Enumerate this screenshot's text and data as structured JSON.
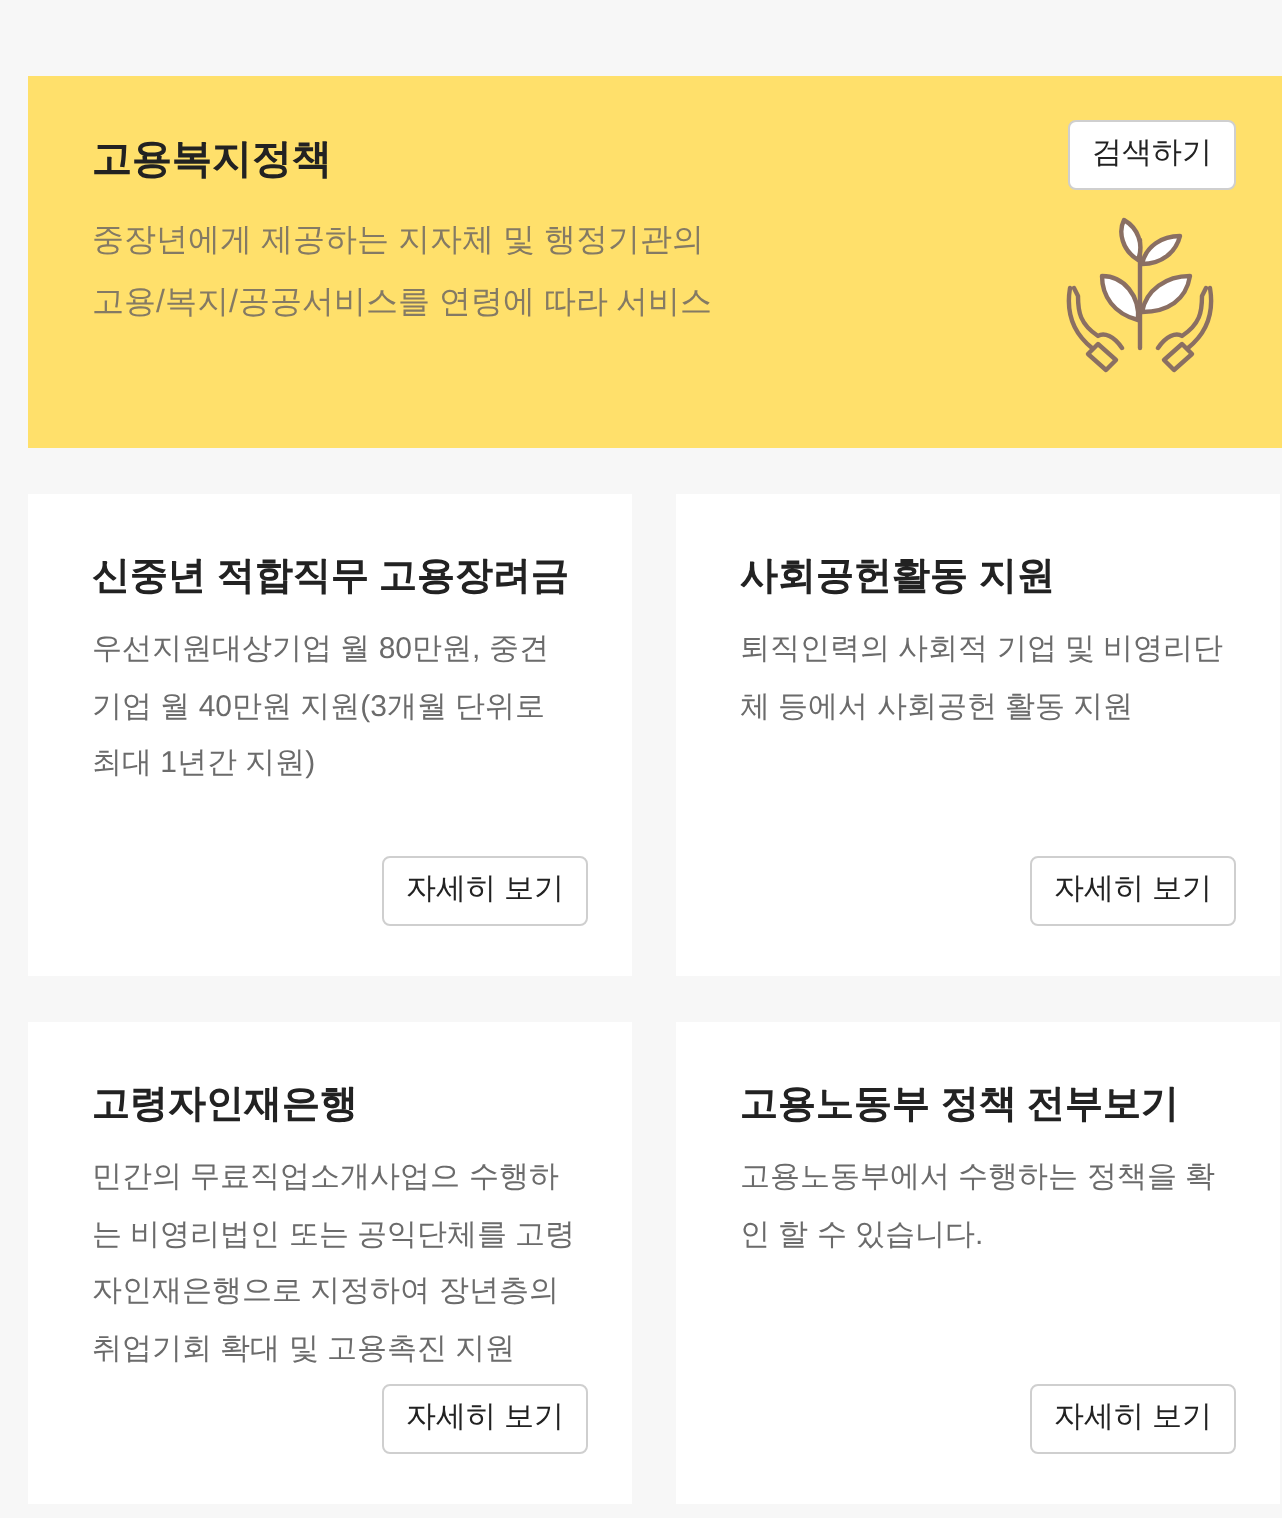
{
  "banner": {
    "title": "고용복지정책",
    "description": "중장년에게 제공하는 지자체 및 행정기관의 고용/복지/공공서비스를 연령에 따라 서비스",
    "button": "검색하기"
  },
  "cards": [
    {
      "title": "신중년 적합직무 고용장려금",
      "description": "우선지원대상기업 월 80만원, 중견기업 월 40만원 지원(3개월 단위로 최대 1년간 지원)",
      "button": "자세히 보기"
    },
    {
      "title": "사회공헌활동 지원",
      "description": "퇴직인력의 사회적 기업 및 비영리단체 등에서 사회공헌 활동 지원",
      "button": "자세히 보기"
    },
    {
      "title": "고령자인재은행",
      "description": "민간의 무료직업소개사업으 수행하는 비영리법인 또는 공익단체를 고령자인재은행으로 지정하여 장년층의 취업기회 확대 및 고용촉진 지원",
      "button": "자세히 보기"
    },
    {
      "title": "고용노동부 정책 전부보기",
      "description": "고용노동부에서 수행하는 정책을 확인 할 수 있습니다.",
      "button": "자세히 보기"
    }
  ]
}
